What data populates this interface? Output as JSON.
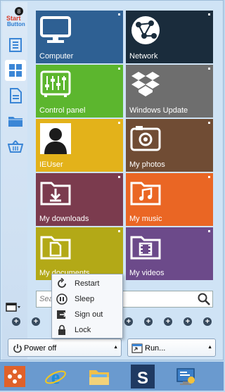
{
  "sidebar": {
    "logo_label": "Start Button",
    "items": [
      {
        "name": "list"
      },
      {
        "name": "tiles"
      },
      {
        "name": "documents"
      },
      {
        "name": "folder"
      },
      {
        "name": "basket"
      }
    ]
  },
  "tiles": [
    {
      "label": "Computer",
      "color": "#2e6093"
    },
    {
      "label": "Network",
      "color": "#1a2c3c"
    },
    {
      "label": "Control panel",
      "color": "#5cb62e"
    },
    {
      "label": "Windows Update",
      "color": "#6e6e6e"
    },
    {
      "label": "IEUser",
      "color": "#e3b21a"
    },
    {
      "label": "My photos",
      "color": "#704c34"
    },
    {
      "label": "My downloads",
      "color": "#7b3b4e"
    },
    {
      "label": "My music",
      "color": "#ea6624"
    },
    {
      "label": "My documents",
      "color": "#b3a917"
    },
    {
      "label": "My videos",
      "color": "#6c4a8a"
    }
  ],
  "search": {
    "placeholder": "Sea"
  },
  "power_menu": [
    {
      "label": "Restart"
    },
    {
      "label": "Sleep"
    },
    {
      "label": "Sign out"
    },
    {
      "label": "Lock"
    }
  ],
  "buttons": {
    "power": "Power off",
    "run": "Run..."
  },
  "plus_symbol": "+"
}
